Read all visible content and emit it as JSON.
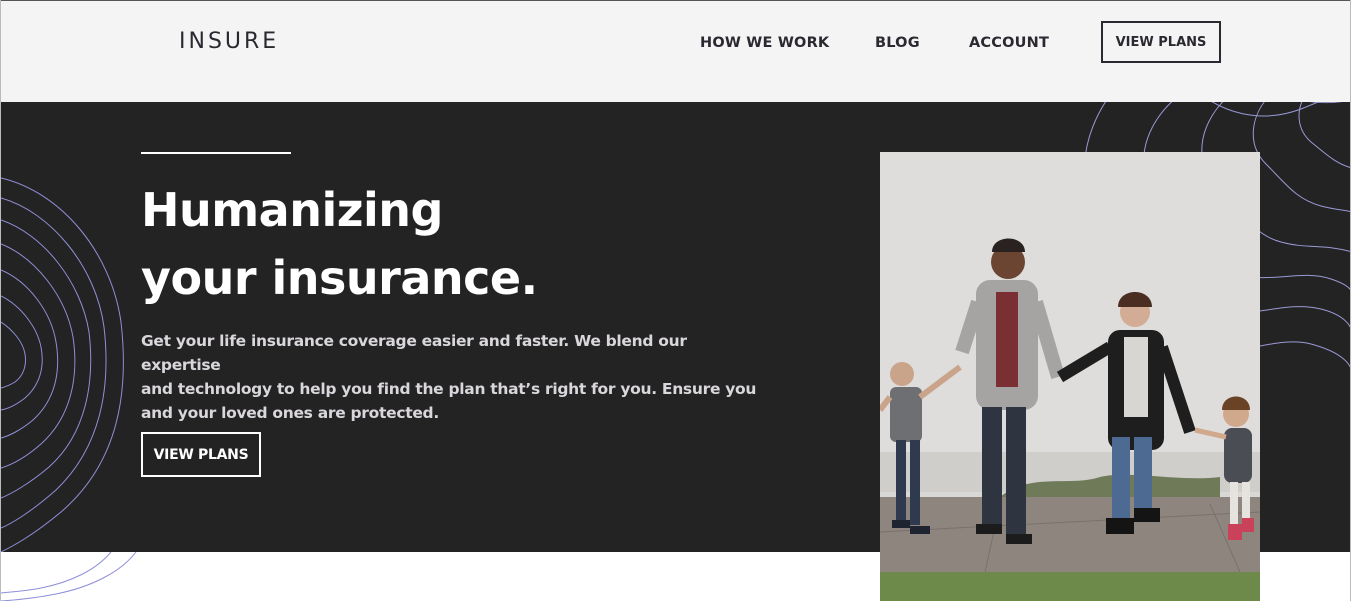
{
  "header": {
    "logo": "INSURE",
    "nav": [
      "HOW WE WORK",
      "BLOG",
      "ACCOUNT"
    ],
    "cta_label": "VIEW PLANS"
  },
  "hero": {
    "title_line1": "Humanizing",
    "title_line2": "your insurance.",
    "body_line1": "Get your life insurance coverage easier and faster. We blend our expertise",
    "body_line2": "and technology to help you find the plan that’s right for you. Ensure you",
    "body_line3": "and your loved ones are protected.",
    "cta_label": "VIEW PLANS"
  },
  "colors": {
    "hero_bg": "#232323",
    "header_bg": "#f4f4f4",
    "pattern": "#8f8fd8",
    "text_dark": "#2c2830"
  }
}
